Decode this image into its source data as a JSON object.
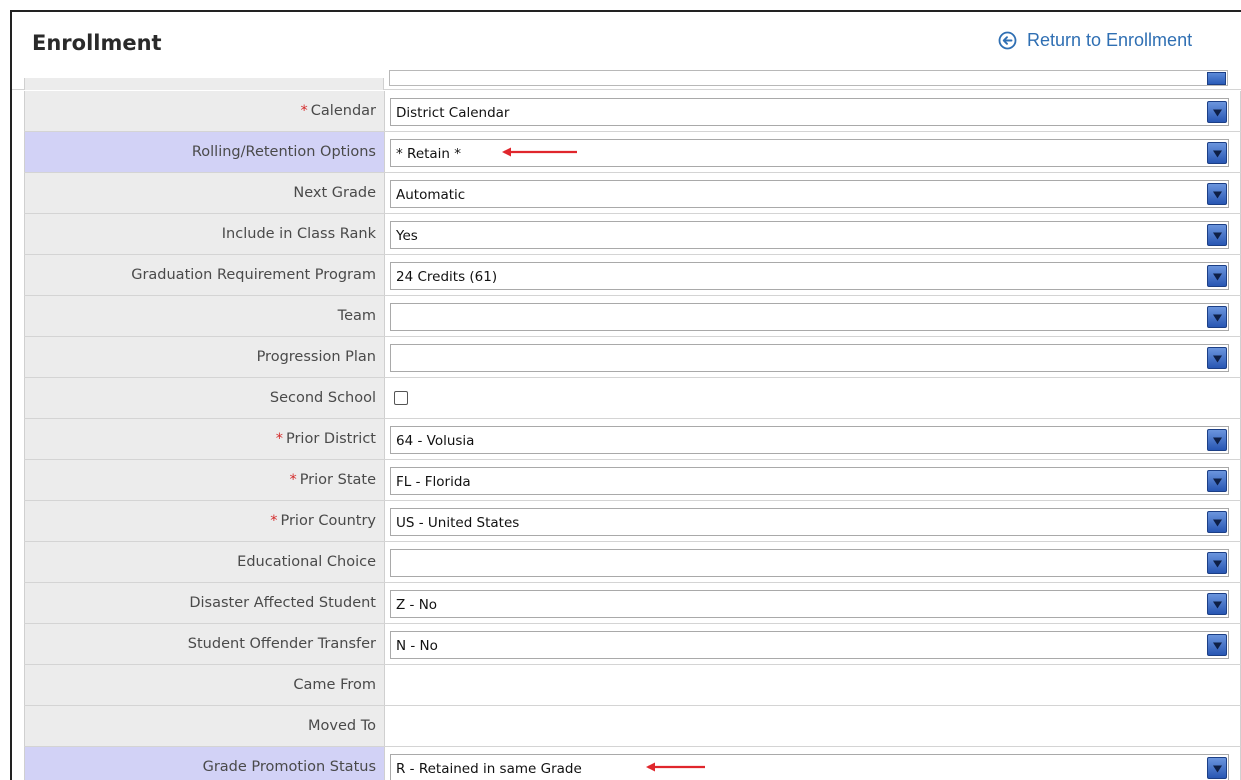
{
  "header": {
    "title": "Enrollment",
    "return_link": "Return to Enrollment",
    "return_icon": "circle-arrow-left-icon"
  },
  "colors": {
    "highlight_label": "#d2d2f6",
    "label_bg": "#ececec",
    "required_marker": "#d42a2a",
    "link": "#2f6fb3",
    "dropdown_arrow": "#2856b3",
    "annotation_arrow": "#e0262c"
  },
  "fields": [
    {
      "label": "Calendar",
      "required_marker": "*",
      "value": "District Calendar"
    },
    {
      "label": "Rolling/Retention Options",
      "value": "* Retain *"
    },
    {
      "label": "Next Grade",
      "value": "Automatic"
    },
    {
      "label": "Include in Class Rank",
      "value": "Yes"
    },
    {
      "label": "Graduation Requirement Program",
      "value": "24 Credits (61)"
    },
    {
      "label": "Team",
      "value": ""
    },
    {
      "label": "Progression Plan",
      "value": ""
    },
    {
      "label": "Second School",
      "checked": false
    },
    {
      "label": "Prior District",
      "required_marker": "*",
      "value": "64 - Volusia"
    },
    {
      "label": "Prior State",
      "required_marker": "*",
      "value": "FL - Florida"
    },
    {
      "label": "Prior Country",
      "required_marker": "*",
      "value": "US - United States"
    },
    {
      "label": "Educational Choice",
      "value": ""
    },
    {
      "label": "Disaster Affected Student",
      "value": "Z - No"
    },
    {
      "label": "Student Offender Transfer",
      "value": "N - No"
    },
    {
      "label": "Came From",
      "value": ""
    },
    {
      "label": "Moved To",
      "value": ""
    },
    {
      "label": "Grade Promotion Status",
      "value": "R - Retained in same Grade"
    }
  ]
}
